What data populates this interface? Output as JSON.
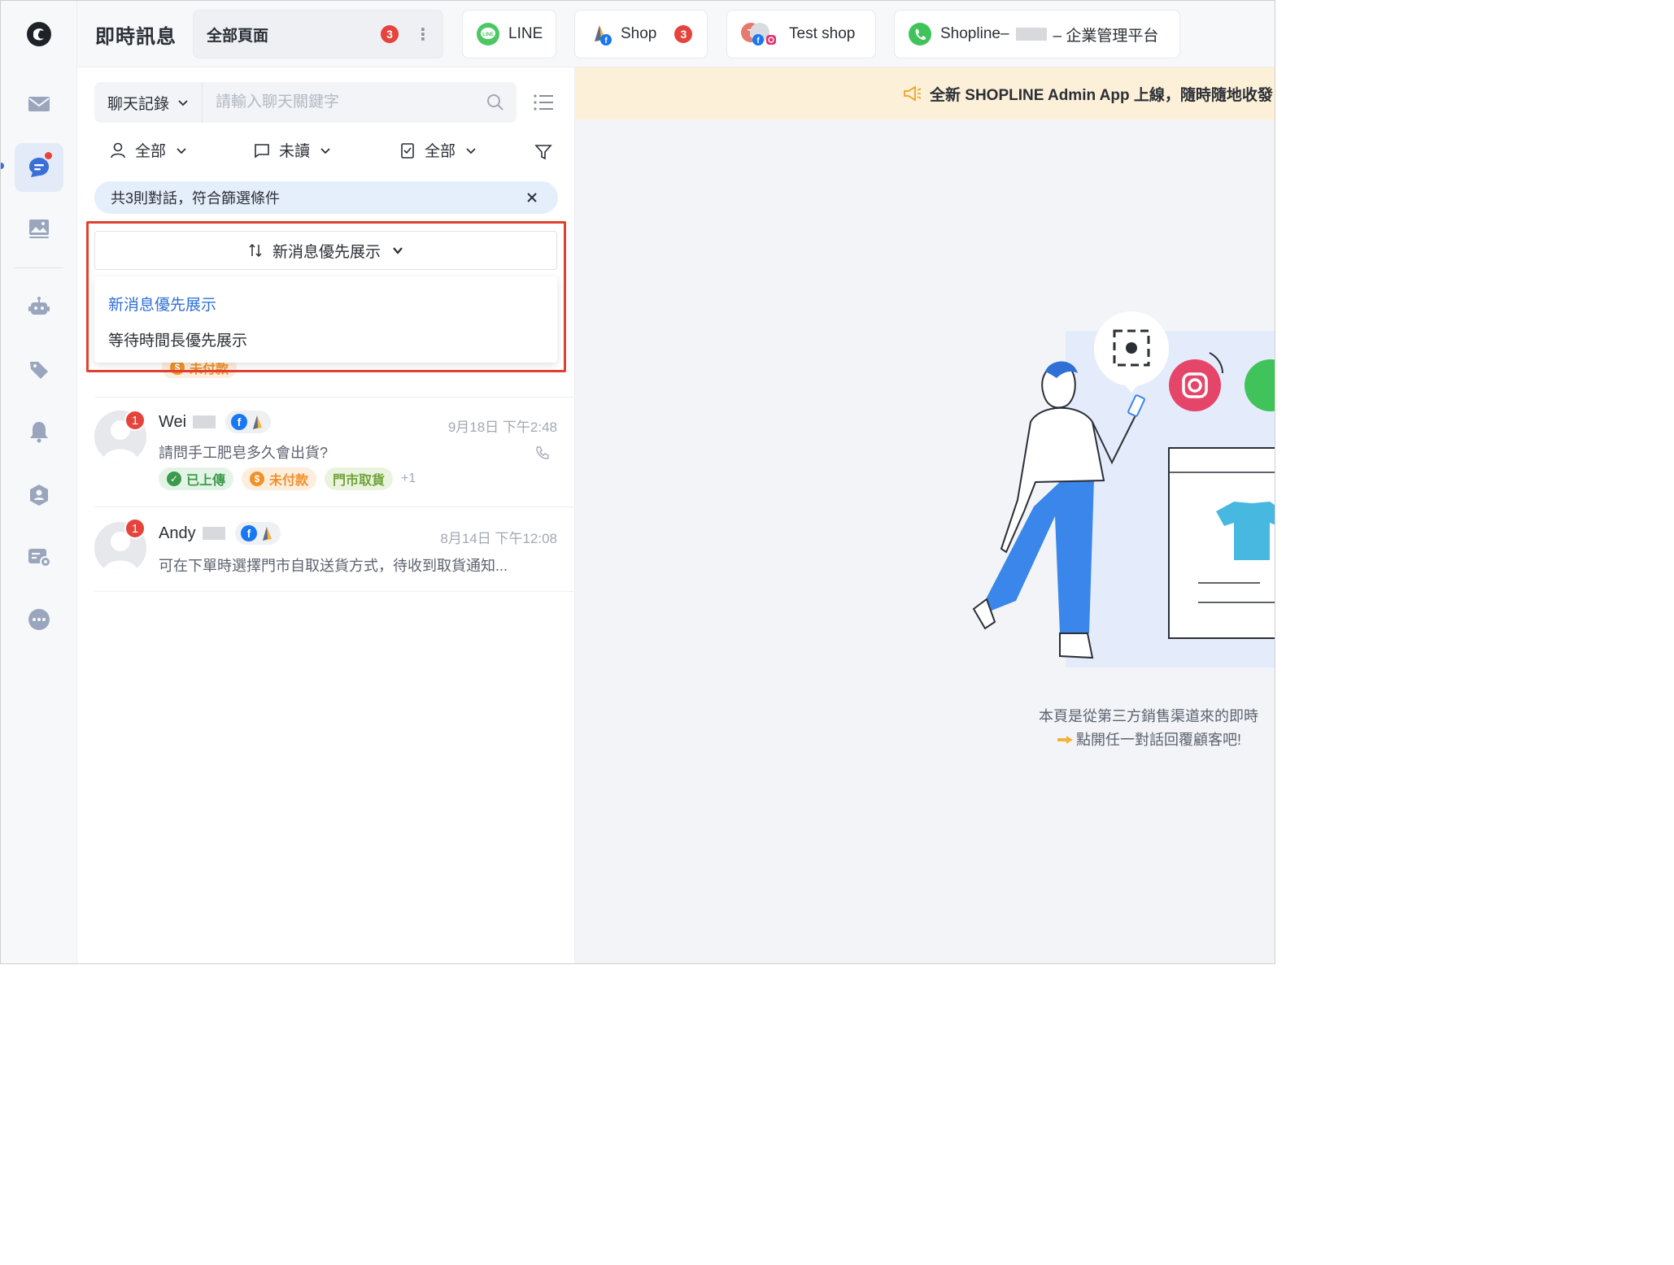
{
  "app": {
    "title": "即時訊息"
  },
  "tabs": [
    {
      "label": "全部頁面",
      "badge": "3",
      "selected": true
    },
    {
      "label": "LINE"
    },
    {
      "label": "Shop",
      "badge": "3"
    },
    {
      "label": "Test shop"
    },
    {
      "label_prefix": "Shopline–",
      "label_suffix": "– 企業管理平台"
    }
  ],
  "search": {
    "scope_label": "聊天記錄",
    "placeholder": "請輸入聊天關鍵字"
  },
  "filters": {
    "assignee": "全部",
    "read_state": "未讀",
    "order_state": "全部"
  },
  "result_bar": {
    "text": "共3則對話，符合篩選條件"
  },
  "sort": {
    "selected_label": "新消息優先展示",
    "options": [
      "新消息優先展示",
      "等待時間長優先展示"
    ]
  },
  "peek_tag": "未付款",
  "conversations": [
    {
      "name": "Wei",
      "unread": "1",
      "time": "9月18日 下午2:48",
      "message": "請問手工肥皂多久會出貨?",
      "tags": [
        "已上傳",
        "未付款",
        "門市取貨"
      ],
      "more_tags": "+1"
    },
    {
      "name": "Andy",
      "unread": "1",
      "time": "8月14日 下午12:08",
      "message": "可在下單時選擇門市自取送貨方式，待收到取貨通知..."
    }
  ],
  "announcement": {
    "text": "全新 SHOPLINE Admin App 上線，隨時隨地收發"
  },
  "empty_state": {
    "line1": "本頁是從第三方銷售渠道來的即時",
    "line2": "點開任一對話回覆顧客吧!"
  },
  "colors": {
    "accent": "#2f6fd6",
    "badge": "#e5433b",
    "highlight": "#e0412f",
    "announce_bg": "#fdf0d8"
  }
}
